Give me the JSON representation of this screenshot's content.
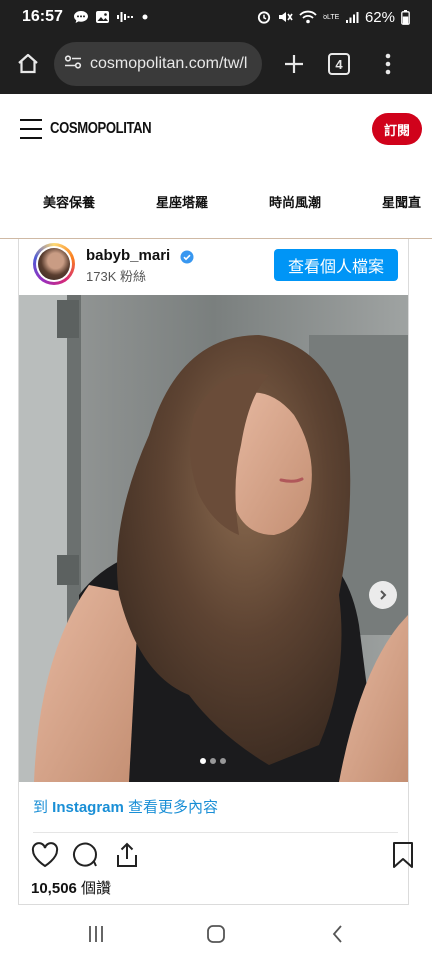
{
  "status_bar": {
    "time": "16:57",
    "battery": "62%",
    "network": "VoLTE1"
  },
  "browser": {
    "url": "cosmopolitan.com/tw/l",
    "tab_count": "4"
  },
  "site": {
    "logo": "COSMOPOLITAN",
    "subscribe_label": "訂閱",
    "nav": [
      "美容保養",
      "星座塔羅",
      "時尚風潮",
      "星聞直"
    ]
  },
  "instagram": {
    "username": "babyb_mari",
    "followers": "173K 粉絲",
    "profile_button": "查看個人檔案",
    "carousel_dots": 3,
    "carousel_active": 0,
    "more_prefix": "到 ",
    "more_brand": "Instagram",
    "more_suffix": " 查看更多內容",
    "likes_count": "10,506",
    "likes_suffix": " 個讚"
  },
  "colors": {
    "brand_red": "#d0021b",
    "ig_blue": "#0095f6",
    "link_blue": "#1a8fd6",
    "chrome_dark": "#1f1f1f"
  },
  "icons": [
    "chat-bubble-icon",
    "gallery-icon",
    "audio-wave-icon",
    "alarm-icon",
    "mute-icon",
    "wifi-icon",
    "signal-icon",
    "battery-icon",
    "home-icon",
    "site-settings-icon",
    "plus-icon",
    "tabs-icon",
    "more-vert-icon",
    "hamburger-icon",
    "verified-icon",
    "chevron-right-icon",
    "heart-icon",
    "comment-icon",
    "share-icon",
    "bookmark-icon",
    "recents-icon",
    "home-nav-icon",
    "back-icon"
  ]
}
